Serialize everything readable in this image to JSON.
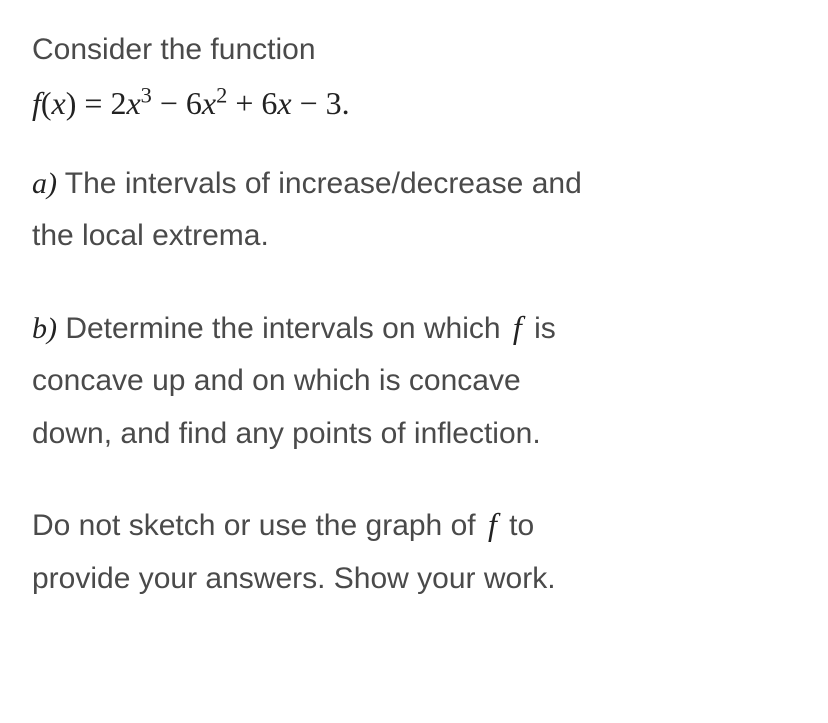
{
  "problem": {
    "intro": "Consider the function",
    "formula_prefix": "f",
    "formula_open": "(",
    "formula_var": "x",
    "formula_close": ")",
    "formula_eq": " = 2",
    "formula_x1": "x",
    "formula_exp1": "3",
    "formula_minus1": " − 6",
    "formula_x2": "x",
    "formula_exp2": "2",
    "formula_plus": " + 6",
    "formula_x3": "x",
    "formula_end": " − 3."
  },
  "parts": {
    "a_label": "a)",
    "a_text1": " The intervals of increase/decrease and",
    "a_text2": "the local extrema.",
    "b_label": "b)",
    "b_text1": " Determine the intervals on which ",
    "b_f1": "f",
    "b_text2": " is",
    "b_text3": "concave up and on which is concave",
    "b_text4": "down, and find any points of inflection."
  },
  "footer": {
    "line1a": "Do not sketch or use the graph of ",
    "line1_f": "f",
    "line1b": " to",
    "line2": "provide your answers. Show your work."
  }
}
